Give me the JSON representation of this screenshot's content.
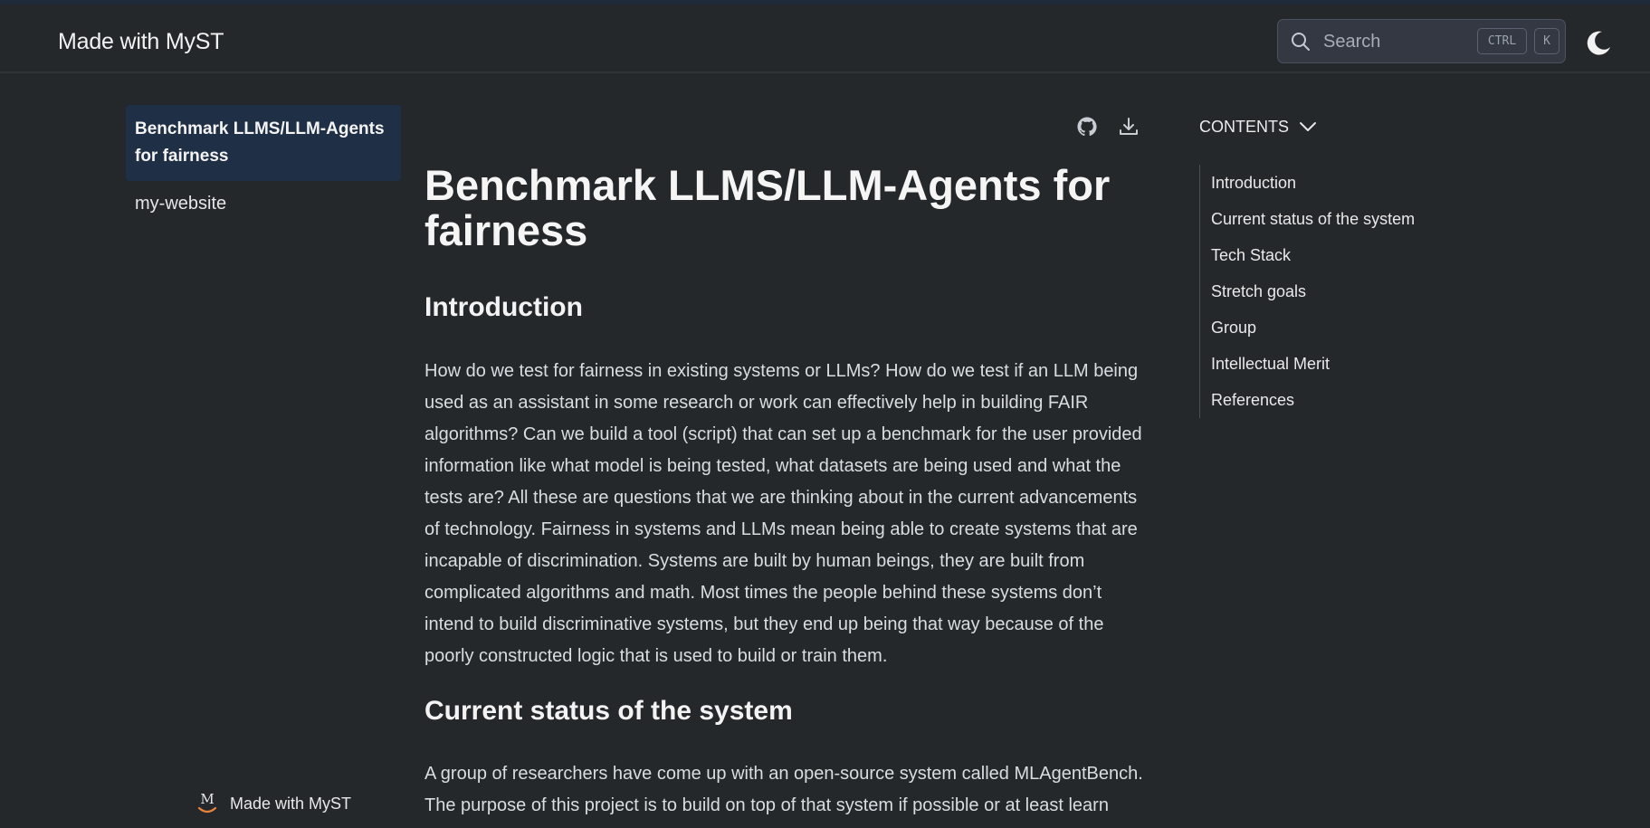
{
  "header": {
    "site_title": "Made with MyST",
    "search_placeholder": "Search",
    "shortcut_ctrl": "CTRL",
    "shortcut_k": "K",
    "theme_icon": "moon-icon"
  },
  "sidebar": {
    "items": [
      {
        "label": "Benchmark LLMS/LLM-Agents for fairness",
        "active": true
      },
      {
        "label": "my-website",
        "active": false
      }
    ],
    "footer_label": "Made with MyST"
  },
  "article": {
    "tool_icons": [
      "github-icon",
      "download-icon"
    ],
    "title": "Benchmark LLMS/LLM-Agents for fairness",
    "sections": [
      {
        "heading": "Introduction",
        "body": "How do we test for fairness in existing systems or LLMs? How do we test if an LLM being used as an assistant in some research or work can effectively help in building FAIR algorithms? Can we build a tool (script) that can set up a benchmark for the user provided information like what model is being tested, what datasets are being used and what the tests are? All these are questions that we are thinking about in the current advancements of technology. Fairness in systems and LLMs mean being able to create systems that are incapable of discrimination. Systems are built by human beings, they are built from complicated algorithms and math. Most times the people behind these systems don’t intend to build discriminative systems, but they end up being that way because of the poorly constructed logic that is used to build or train them."
      },
      {
        "heading": "Current status of the system",
        "body": "A group of researchers have come up with an open-source system called MLAgentBench. The purpose of this project is to build on top of that system if possible or at least learn"
      }
    ]
  },
  "toc": {
    "header": "CONTENTS",
    "items": [
      "Introduction",
      "Current status of the system",
      "Tech Stack",
      "Stretch goals",
      "Group",
      "Intellectual Merit",
      "References"
    ]
  },
  "colors": {
    "background": "#25282b",
    "active_nav_bg": "#1f2f45",
    "search_bg": "#333842"
  }
}
